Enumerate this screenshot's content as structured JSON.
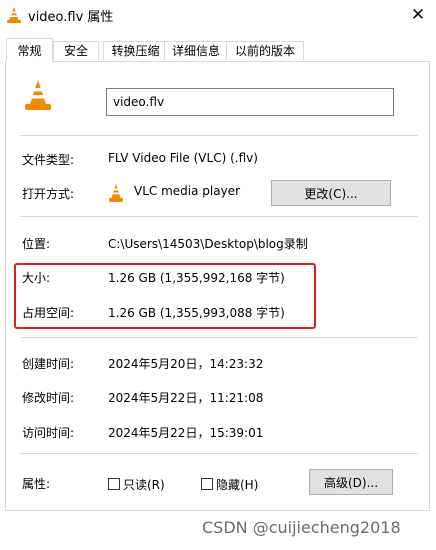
{
  "window": {
    "title": "video.flv 属性",
    "close_glyph": "✕"
  },
  "tabs": [
    {
      "label": "常规",
      "active": true
    },
    {
      "label": "安全"
    },
    {
      "label": "转换压缩"
    },
    {
      "label": "详细信息"
    },
    {
      "label": "以前的版本"
    }
  ],
  "general": {
    "filename": "video.flv",
    "file_type_label": "文件类型:",
    "file_type_value": "FLV Video File (VLC) (.flv)",
    "opens_with_label": "打开方式:",
    "opens_with_app": "VLC media player",
    "change_button": "更改(C)...",
    "location_label": "位置:",
    "location_value": "C:\\Users\\14503\\Desktop\\blog录制",
    "size_label": "大小:",
    "size_value": "1.26 GB (1,355,992,168 字节)",
    "size_on_disk_label": "占用空间:",
    "size_on_disk_value": "1.26 GB (1,355,993,088 字节)",
    "created_label": "创建时间:",
    "created_value": "2024年5月20日，14:23:32",
    "modified_label": "修改时间:",
    "modified_value": "2024年5月22日，11:21:08",
    "accessed_label": "访问时间:",
    "accessed_value": "2024年5月22日，15:39:01",
    "attributes_label": "属性:",
    "readonly_label": "只读(R)",
    "hidden_label": "隐藏(H)",
    "advanced_button": "高级(D)..."
  },
  "watermark": "CSDN @cuijiecheng2018",
  "colors": {
    "vlc_orange": "#f08a00",
    "highlight_red": "#e02020",
    "button_bg": "#e1e1e1"
  }
}
